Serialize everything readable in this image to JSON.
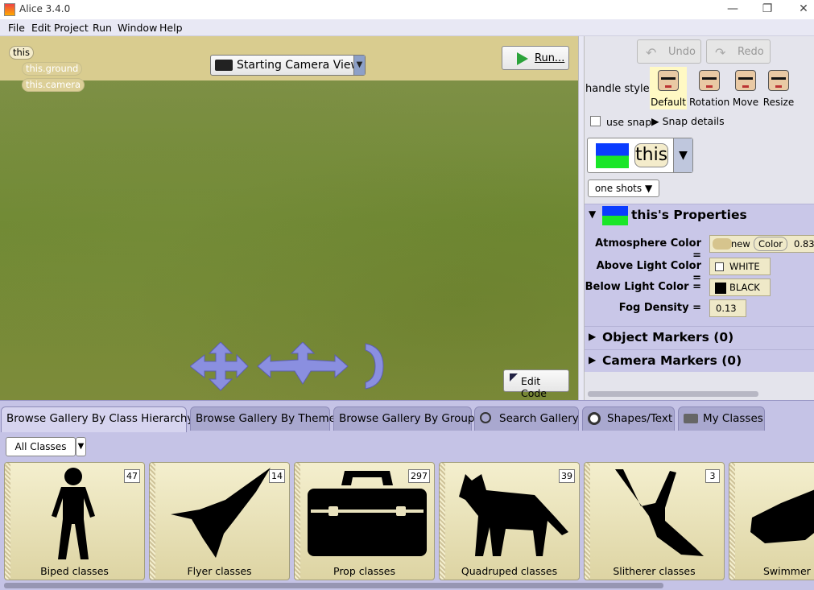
{
  "window": {
    "title": "Alice 3.4.0"
  },
  "menu": [
    "File",
    "Edit",
    "Project",
    "Run",
    "Window",
    "Help"
  ],
  "scene": {
    "this_chip": "this",
    "ground_chip": "this.ground",
    "camera_chip": "this.camera",
    "camera_view": "Starting Camera View",
    "run_button": "Run...",
    "edit_code_button": "Edit Code"
  },
  "right_panel": {
    "undo": "Undo",
    "redo": "Redo",
    "handle_style_label": "handle style:",
    "handle_styles": [
      "Default",
      "Rotation",
      "Move",
      "Resize"
    ],
    "use_snap": "use snap",
    "snap_details": "Snap details",
    "selected": "this",
    "one_shots": "one shots ▼",
    "properties_title": "this's Properties",
    "properties": [
      {
        "label": "Atmosphere Color =",
        "value_new": "new",
        "value_class": "Color",
        "value_num": "0.83"
      },
      {
        "label": "Above Light Color =",
        "value": "WHITE"
      },
      {
        "label": "Below Light Color =",
        "value": "BLACK"
      },
      {
        "label": "Fog Density =",
        "value": "0.13"
      }
    ],
    "object_markers": "Object Markers (0)",
    "camera_markers": "Camera Markers (0)"
  },
  "gallery": {
    "tabs": [
      "Browse Gallery By Class Hierarchy",
      "Browse Gallery By Theme",
      "Browse Gallery By Group",
      "Search Gallery",
      "Shapes/Text",
      "My Classes"
    ],
    "filter": "All Classes",
    "cards": [
      {
        "label": "Biped classes",
        "count": "47"
      },
      {
        "label": "Flyer classes",
        "count": "14"
      },
      {
        "label": "Prop classes",
        "count": "297"
      },
      {
        "label": "Quadruped classes",
        "count": "39"
      },
      {
        "label": "Slitherer classes",
        "count": "3"
      },
      {
        "label": "Swimmer cl",
        "count": ""
      }
    ]
  },
  "colors": {
    "accent": "#c5c3e6",
    "tile": "#efe9c8",
    "run_icon": "#2ba33a"
  }
}
